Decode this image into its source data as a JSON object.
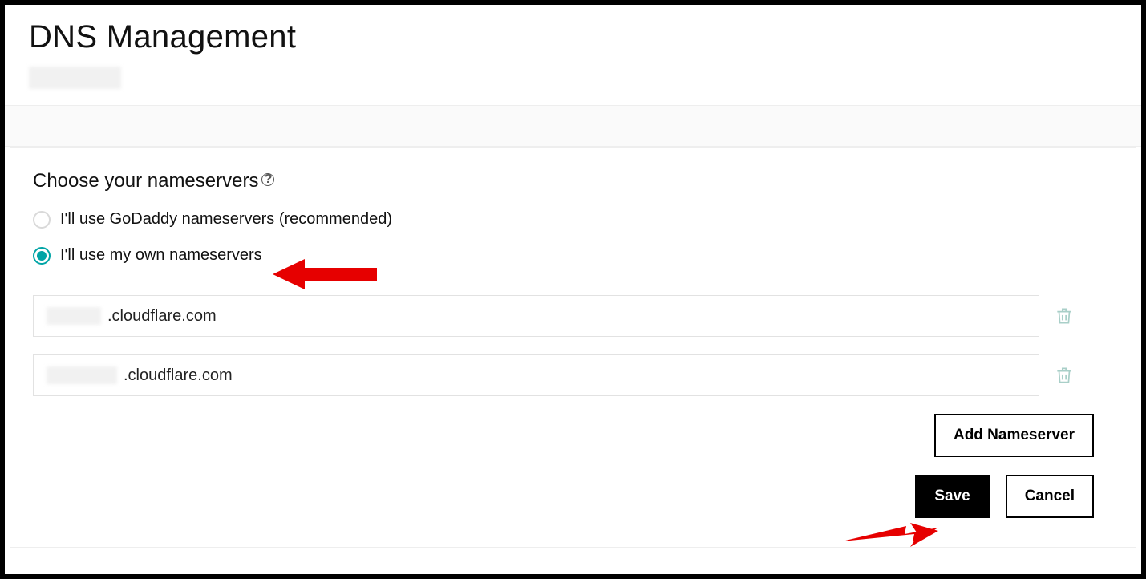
{
  "header": {
    "title": "DNS Management"
  },
  "section": {
    "title": "Choose your nameservers"
  },
  "options": {
    "godaddy": {
      "label": "I'll use GoDaddy nameservers (recommended)",
      "selected": false
    },
    "custom": {
      "label": "I'll use my own nameservers",
      "selected": true
    }
  },
  "nameservers": [
    {
      "suffix": ".cloudflare.com"
    },
    {
      "suffix": ".cloudflare.com"
    }
  ],
  "buttons": {
    "add": "Add Nameserver",
    "save": "Save",
    "cancel": "Cancel"
  },
  "icons": {
    "help": "?",
    "trash": "trash-icon",
    "arrow": "arrow-icon"
  },
  "colors": {
    "accent": "#00a4a6",
    "arrow": "#e60000"
  }
}
